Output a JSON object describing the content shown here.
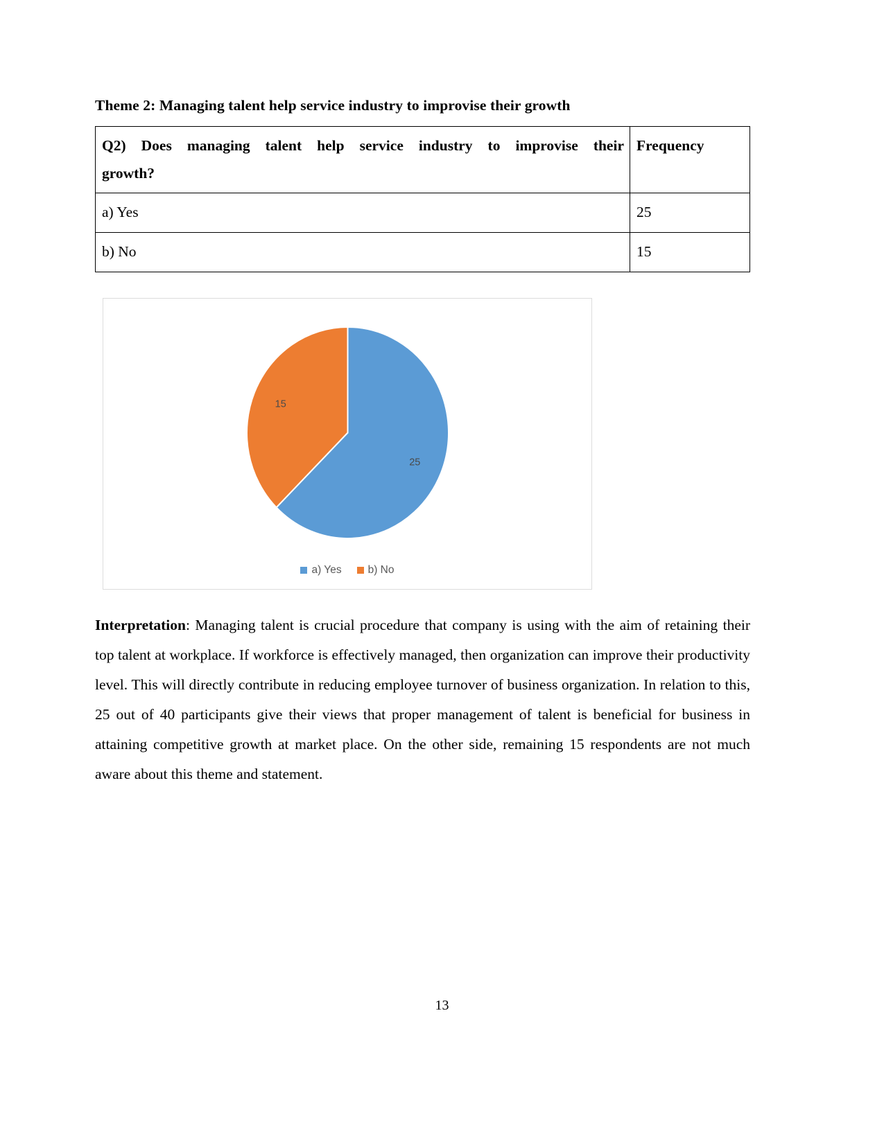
{
  "document": {
    "theme_heading": "Theme 2: Managing talent help service industry to improvise their growth",
    "page_number": "13"
  },
  "table": {
    "question_line1": "Q2) Does managing talent help service industry to improvise their",
    "question_line2": "growth?",
    "frequency_header": "Frequency",
    "rows": [
      {
        "option": "a) Yes",
        "frequency": "25"
      },
      {
        "option": "b) No",
        "frequency": "15"
      }
    ]
  },
  "chart_data": {
    "type": "pie",
    "title": "",
    "categories": [
      "a) Yes",
      "b) No"
    ],
    "values": [
      25,
      15
    ],
    "labels": [
      "25",
      "15"
    ],
    "colors": [
      "#5B9BD5",
      "#ED7D31"
    ],
    "legend": [
      "a) Yes",
      "b) No"
    ],
    "legend_position": "bottom",
    "total": 40,
    "start_angle_deg": 0,
    "label_color": "#4A4A4A",
    "border_color": "#DCDCDC"
  },
  "interpretation": {
    "lead": "Interpretation",
    "body": ": Managing talent is crucial procedure that company is using with the aim of retaining their top talent at workplace. If workforce is effectively managed, then organization can improve their productivity level. This will directly contribute in reducing employee turnover of business organization. In relation to this, 25 out of 40 participants give their views that proper management of talent is beneficial for business in attaining competitive growth at market place. On the other side, remaining 15 respondents are not much aware about this theme and statement."
  }
}
